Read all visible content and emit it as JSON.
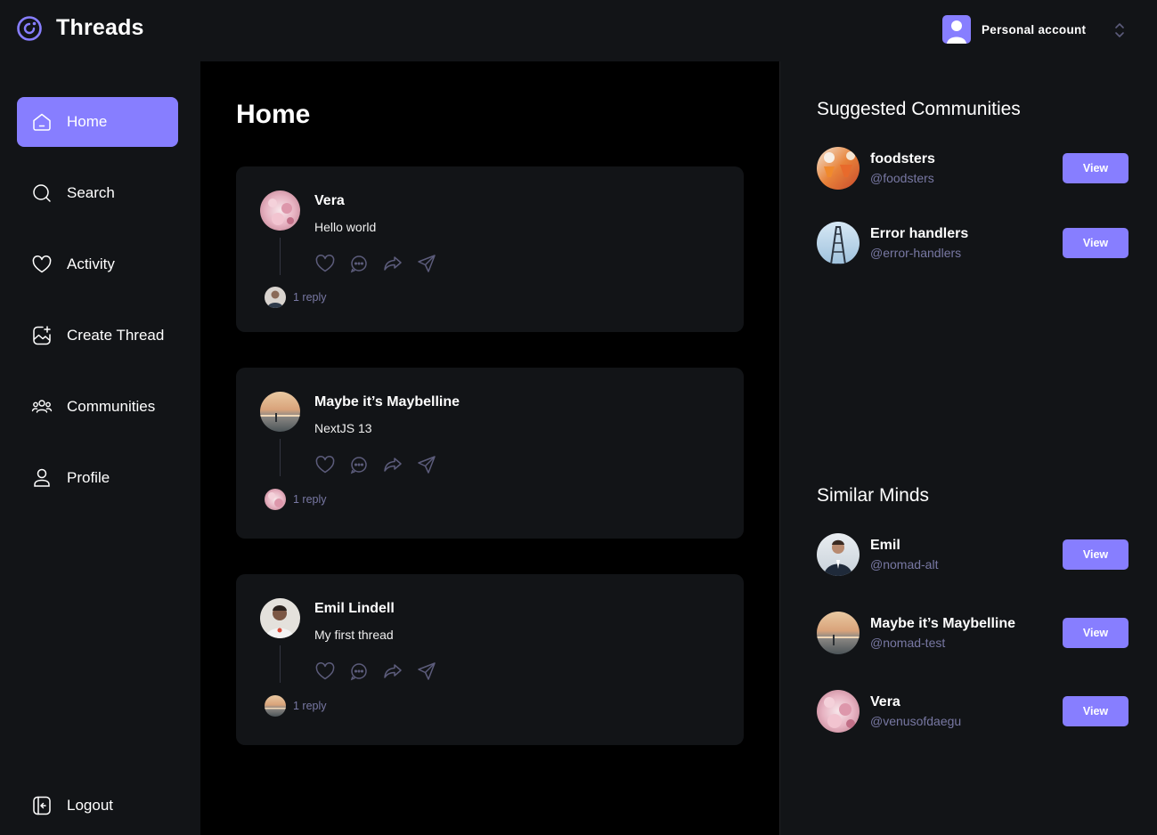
{
  "app": {
    "title": "Threads"
  },
  "account": {
    "label": "Personal account"
  },
  "sidebar": {
    "items": [
      {
        "label": "Home",
        "icon": "home-icon",
        "active": true
      },
      {
        "label": "Search",
        "icon": "search-icon"
      },
      {
        "label": "Activity",
        "icon": "heart-icon"
      },
      {
        "label": "Create Thread",
        "icon": "create-thread-icon"
      },
      {
        "label": "Communities",
        "icon": "communities-icon"
      },
      {
        "label": "Profile",
        "icon": "user-icon"
      }
    ],
    "logout": {
      "label": "Logout",
      "icon": "logout-icon"
    }
  },
  "main": {
    "title": "Home",
    "posts": [
      {
        "author": "Vera",
        "content": "Hello world",
        "replies": "1 reply",
        "avatar": "cherry-blossom"
      },
      {
        "author": "Maybe it’s Maybelline",
        "content": "NextJS 13",
        "replies": "1 reply",
        "avatar": "sunset-beach"
      },
      {
        "author": "Emil Lindell",
        "content": "My first thread",
        "replies": "1 reply",
        "avatar": "man-portrait"
      }
    ]
  },
  "right": {
    "suggested_title": "Suggested Communities",
    "communities": [
      {
        "name": "foodsters",
        "handle": "@foodsters",
        "button": "View"
      },
      {
        "name": "Error handlers",
        "handle": "@error-handlers",
        "button": "View"
      }
    ],
    "similar_title": "Similar Minds",
    "users": [
      {
        "name": "Emil",
        "handle": "@nomad-alt",
        "button": "View"
      },
      {
        "name": "Maybe it’s Maybelline",
        "handle": "@nomad-test",
        "button": "View"
      },
      {
        "name": "Vera",
        "handle": "@venusofdaegu",
        "button": "View"
      }
    ]
  },
  "colors": {
    "accent": "#877eff",
    "bg": "#121417",
    "feed_bg": "#000000",
    "muted": "#7878a3"
  }
}
